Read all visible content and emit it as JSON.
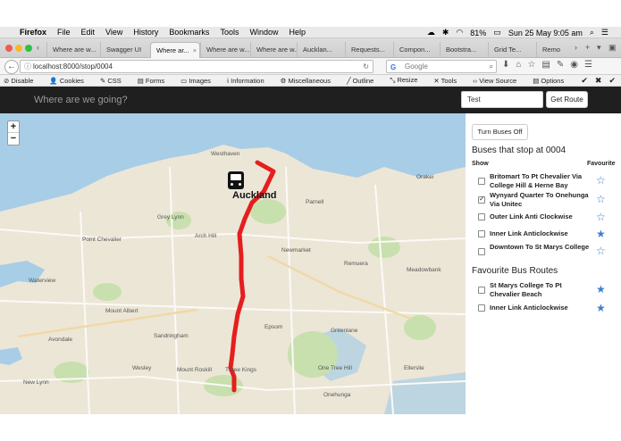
{
  "menubar": {
    "app": "Firefox",
    "items": [
      "File",
      "Edit",
      "View",
      "History",
      "Bookmarks",
      "Tools",
      "Window",
      "Help"
    ],
    "battery": "81%",
    "clock": "Sun 25 May  9:05 am"
  },
  "tabs": [
    {
      "label": "Where are w..."
    },
    {
      "label": "Swagger UI"
    },
    {
      "label": "Where ar..."
    },
    {
      "label": "Where are w..."
    },
    {
      "label": "Where are w..."
    },
    {
      "label": "Aucklan..."
    },
    {
      "label": "Requests..."
    },
    {
      "label": "Compon..."
    },
    {
      "label": "Bootstra..."
    },
    {
      "label": "Grid Te..."
    },
    {
      "label": "Remo"
    }
  ],
  "nav": {
    "url": "localhost:8000/stop/0004",
    "search_placeholder": "Google"
  },
  "devbar": {
    "items": [
      "Disable",
      "Cookies",
      "CSS",
      "Forms",
      "Images",
      "Information",
      "Miscellaneous",
      "Outline",
      "Resize",
      "Tools",
      "View Source",
      "Options"
    ]
  },
  "app": {
    "title": "Where are we going?",
    "stop_value": "Test",
    "route_button": "Get Route",
    "toggle_buses": "Turn Buses Off"
  },
  "panel": {
    "stops_heading": "Buses that stop at 0004",
    "show_label": "Show",
    "favourite_label": "Favourite",
    "buses": [
      {
        "name": "Britomart To Pt Chevalier Via College Hill & Herne Bay",
        "checked": false,
        "favourite": false
      },
      {
        "name": "Wynyard Quarter To Onehunga Via Unitec",
        "checked": true,
        "favourite": false
      },
      {
        "name": "Outer Link Anti Clockwise",
        "checked": false,
        "favourite": false
      },
      {
        "name": "Inner Link Anticlockwise",
        "checked": false,
        "favourite": true
      },
      {
        "name": "Downtown To St Marys College",
        "checked": false,
        "favourite": false
      }
    ],
    "favourites_heading": "Favourite Bus Routes",
    "favourites": [
      {
        "name": "St Marys College To Pt Chevalier Beach",
        "checked": false,
        "favourite": true
      },
      {
        "name": "Inner Link Anticlockwise",
        "checked": false,
        "favourite": true
      }
    ]
  },
  "map": {
    "city": "Auckland",
    "labels": [
      "Westhaven",
      "Parnell",
      "Newmarket",
      "Grey Lynn",
      "Arch Hill",
      "Point Chevalier",
      "Waterview",
      "Mount Albert",
      "Sandringham",
      "Epsom",
      "Greenlane",
      "Remuera",
      "Meadowbank",
      "Mount Roskill",
      "Three Kings",
      "One Tree Hill",
      "Wesley",
      "Onehunga",
      "Avondale",
      "New Lynn",
      "Ellerslie",
      "Orakei"
    ],
    "route_color": "#e51e1e"
  }
}
